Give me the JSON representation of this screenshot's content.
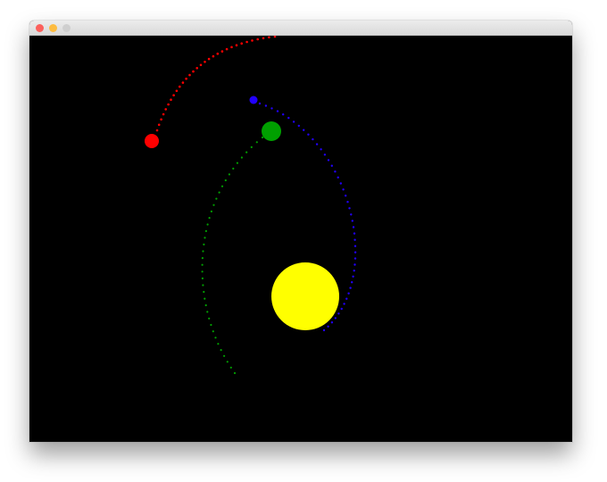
{
  "window": {
    "controls": {
      "close_color": "#fc605c",
      "minimize_color": "#fdbc40",
      "zoom_color": "#cfcfcf"
    }
  },
  "scene": {
    "background_color": "#000000",
    "bodies": [
      {
        "name": "sun",
        "color": "#ffff00"
      },
      {
        "name": "planet-red",
        "color": "#ff0000"
      },
      {
        "name": "planet-green",
        "color": "#00a000"
      },
      {
        "name": "planet-blue",
        "color": "#2200ff"
      }
    ],
    "trails": [
      {
        "body": "planet-red",
        "color": "#ff0000"
      },
      {
        "body": "planet-green",
        "color": "#00a000"
      },
      {
        "body": "planet-blue",
        "color": "#2200ff"
      }
    ]
  }
}
